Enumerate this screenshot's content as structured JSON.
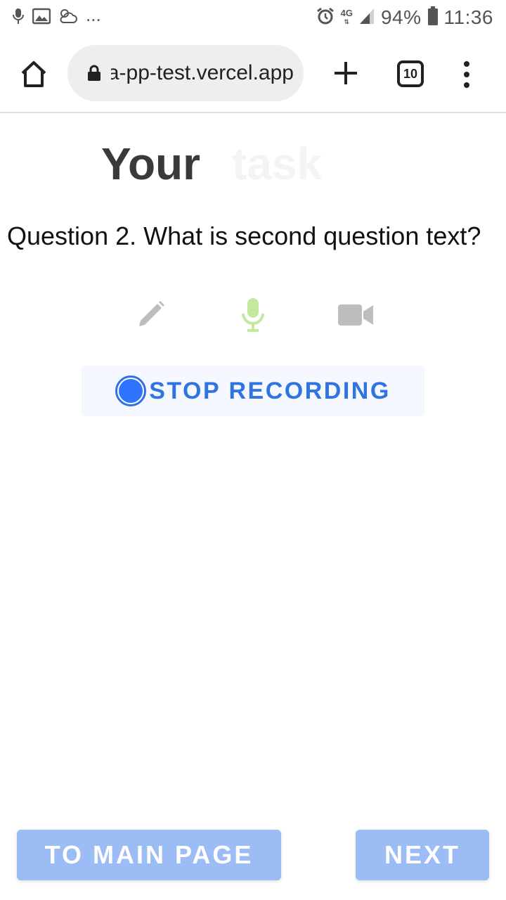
{
  "status_bar": {
    "notification_icons": [
      "mic-notification-icon",
      "image-notification-icon",
      "weather-notification-icon"
    ],
    "overflow_dots": "...",
    "network_type": "4G",
    "battery_percent": "94%",
    "time": "11:36"
  },
  "browser": {
    "url": "pwa-pp-test.vercel.app",
    "tab_count": "10",
    "icons": [
      "home-icon",
      "lock-icon",
      "new-tab-icon",
      "tab-switcher-icon",
      "more-menu-icon"
    ]
  },
  "page": {
    "heading_visible": "Your",
    "heading_faded": "task",
    "question": "Question 2. What is second question text?",
    "answer_modes": [
      {
        "name": "text",
        "icon": "pencil-icon",
        "active": false
      },
      {
        "name": "audio",
        "icon": "microphone-icon",
        "active": true
      },
      {
        "name": "video",
        "icon": "video-camera-icon",
        "active": false
      }
    ],
    "record_button_label": "STOP RECORDING",
    "to_main_page_label": "TO MAIN PAGE",
    "next_label": "NEXT"
  },
  "colors": {
    "accent_blue": "#2f74e0",
    "disabled_button_blue": "#9cbcf6",
    "active_mode_green": "#c5e8a0",
    "inactive_mode_gray": "#bdbdbd"
  }
}
